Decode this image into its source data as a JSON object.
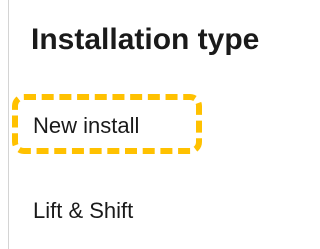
{
  "header": {
    "title": "Installation type"
  },
  "options": [
    {
      "label": "New install"
    },
    {
      "label": "Lift & Shift"
    }
  ],
  "highlight": {
    "target": "New install",
    "color": "#ffc100",
    "style": "dashed"
  }
}
